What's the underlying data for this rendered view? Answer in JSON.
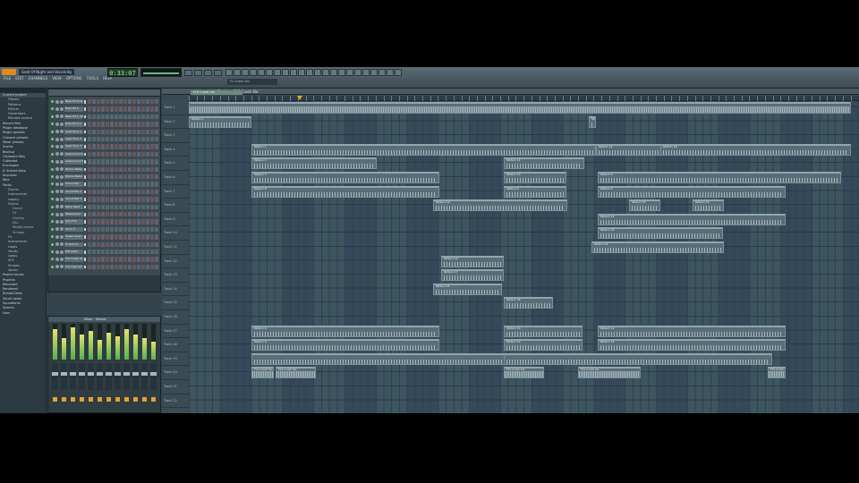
{
  "app": {
    "title": "FL Studio",
    "project_title": "Gold Of Night and Vocals-By"
  },
  "menu": [
    "FILE",
    "EDIT",
    "CHANNELS",
    "VIEW",
    "OPTIONS",
    "TOOLS",
    "HELP"
  ],
  "transport": {
    "time": "0:33:07"
  },
  "hint": "FL Crash Slo",
  "browser": {
    "items": [
      {
        "label": "Current project",
        "level": 0
      },
      {
        "label": "History",
        "level": 1
      },
      {
        "label": "Patterns",
        "level": 1
      },
      {
        "label": "Effects",
        "level": 1
      },
      {
        "label": "Generators",
        "level": 1
      },
      {
        "label": "Remote control",
        "level": 1
      },
      {
        "label": "Recent files",
        "level": 0
      },
      {
        "label": "Plugin database",
        "level": 0
      },
      {
        "label": "Plugin presets",
        "level": 0
      },
      {
        "label": "Channel presets",
        "level": 0
      },
      {
        "label": "Mixer presets",
        "level": 0
      },
      {
        "label": "Scores",
        "level": 0
      },
      {
        "label": "Backup",
        "level": 0
      },
      {
        "label": "Clipboard files",
        "level": 0
      },
      {
        "label": "Collected",
        "level": 0
      },
      {
        "label": "Envelopes",
        "level": 0
      },
      {
        "label": "IL Shared Data",
        "level": 0
      },
      {
        "label": "Impulses",
        "level": 0
      },
      {
        "label": "Misc",
        "level": 0
      },
      {
        "label": "Packs",
        "level": 0
      },
      {
        "label": "Drums",
        "level": 1
      },
      {
        "label": "Instruments",
        "level": 1
      },
      {
        "label": "Legacy",
        "level": 1
      },
      {
        "label": "Drums",
        "level": 1
      },
      {
        "label": "Dance",
        "level": 2
      },
      {
        "label": "FX",
        "level": 2
      },
      {
        "label": "HipHop",
        "level": 2
      },
      {
        "label": "Kits",
        "level": 2
      },
      {
        "label": "RealDrumkits",
        "level": 2
      },
      {
        "label": "Vintage",
        "level": 2
      },
      {
        "label": "FX",
        "level": 1
      },
      {
        "label": "Instruments",
        "level": 1
      },
      {
        "label": "Loops",
        "level": 1
      },
      {
        "label": "Vocals",
        "level": 1
      },
      {
        "label": "Loops",
        "level": 1
      },
      {
        "label": "SFX",
        "level": 1
      },
      {
        "label": "Shapes",
        "level": 1
      },
      {
        "label": "Vocals",
        "level": 1
      },
      {
        "label": "Project bones",
        "level": 0
      },
      {
        "label": "Projects",
        "level": 0
      },
      {
        "label": "Recorded",
        "level": 0
      },
      {
        "label": "Rendered",
        "level": 0
      },
      {
        "label": "Shared Data",
        "level": 0
      },
      {
        "label": "Sliced beats",
        "level": 0
      },
      {
        "label": "Soundfonts",
        "level": 0
      },
      {
        "label": "Speech",
        "level": 0
      },
      {
        "label": "User",
        "level": 0
      }
    ]
  },
  "channels": [
    "Bass Kit (Lead)",
    "Bass Kit 2",
    "Bass Kit 2 (dl)",
    "Bass Kit 3 e",
    "Lead Tone 1",
    "Lead Tone 2",
    "Lead Tone 3",
    "Lead Sound 2",
    "Lead Sound 4",
    "Plucks Metal",
    "Plucks Metal",
    "Chord Pad",
    "Chord Pad b",
    "Chord Pad 2",
    "Warp Lead",
    "Wavestand",
    "Kick Frill",
    "Pluck 2",
    "Vowel Layer",
    "Hi Hat C1",
    "Hat Open",
    "FLS Crash Slo",
    "FLS Clap Slo"
  ],
  "mixer": {
    "title": "Mixer - Master",
    "levels": [
      0.85,
      0.6,
      0.9,
      0.7,
      0.8,
      0.55,
      0.75,
      0.65,
      0.85,
      0.7,
      0.6,
      0.5
    ]
  },
  "playlist": {
    "title": "Playlist - FLS Crash Slo",
    "pattern_selector": "FLS Crash Slo",
    "tracks": [
      "Track 1",
      "Track 2",
      "Track 3",
      "Track 4",
      "Track 5",
      "Track 6",
      "Track 7",
      "Track 8",
      "Track 9",
      "Track 10",
      "Track 11",
      "Track 12",
      "Track 13",
      "Track 14",
      "Track 15",
      "Track 16",
      "Track 17",
      "Track 18",
      "Track 19",
      "Track 20",
      "Track 21",
      "Track 22"
    ],
    "clips": [
      {
        "label": "",
        "track": 0,
        "start": 0,
        "len": 740,
        "kind": "wave"
      },
      {
        "label": "Pattern 1",
        "track": 1,
        "start": 0,
        "len": 70,
        "kind": "notes"
      },
      {
        "label": "Pattern 2",
        "track": 1,
        "start": 447,
        "len": 8,
        "kind": "notes"
      },
      {
        "label": "Pattern 1",
        "track": 3,
        "start": 70,
        "len": 385,
        "kind": "notes"
      },
      {
        "label": "Pattern 14",
        "track": 3,
        "start": 455,
        "len": 100,
        "kind": "notes"
      },
      {
        "label": "Pattern 18",
        "track": 3,
        "start": 527,
        "len": 213,
        "kind": "notes"
      },
      {
        "label": "Pattern 4",
        "track": 4,
        "start": 70,
        "len": 140,
        "kind": "notes"
      },
      {
        "label": "Pattern 11",
        "track": 4,
        "start": 352,
        "len": 90,
        "kind": "notes"
      },
      {
        "label": "Pattern 7",
        "track": 5,
        "start": 70,
        "len": 210,
        "kind": "notes"
      },
      {
        "label": "Pattern 13",
        "track": 5,
        "start": 352,
        "len": 70,
        "kind": "notes"
      },
      {
        "label": "Pattern 5",
        "track": 5,
        "start": 457,
        "len": 272,
        "kind": "notes"
      },
      {
        "label": "Pattern 8",
        "track": 6,
        "start": 70,
        "len": 210,
        "kind": "notes"
      },
      {
        "label": "Pattern 9",
        "track": 6,
        "start": 352,
        "len": 70,
        "kind": "notes"
      },
      {
        "label": "Pattern 3",
        "track": 6,
        "start": 457,
        "len": 210,
        "kind": "notes"
      },
      {
        "label": "Pattern 19",
        "track": 7,
        "start": 273,
        "len": 150,
        "kind": "notes"
      },
      {
        "label": "Pattern 20",
        "track": 7,
        "start": 492,
        "len": 35,
        "kind": "notes"
      },
      {
        "label": "Pattern 22",
        "track": 7,
        "start": 563,
        "len": 35,
        "kind": "notes"
      },
      {
        "label": "Pattern 21",
        "track": 8,
        "start": 457,
        "len": 210,
        "kind": "notes"
      },
      {
        "label": "Pattern 23",
        "track": 9,
        "start": 457,
        "len": 140,
        "kind": "notes"
      },
      {
        "label": "Pattern 24",
        "track": 10,
        "start": 450,
        "len": 148,
        "kind": "notes"
      },
      {
        "label": "Pattern 16",
        "track": 11,
        "start": 282,
        "len": 70,
        "kind": "notes"
      },
      {
        "label": "Pattern 17",
        "track": 12,
        "start": 282,
        "len": 70,
        "kind": "notes"
      },
      {
        "label": "Pattern 15",
        "track": 13,
        "start": 273,
        "len": 77,
        "kind": "notes"
      },
      {
        "label": "Pattern 26",
        "track": 14,
        "start": 352,
        "len": 55,
        "kind": "notes"
      },
      {
        "label": "Pattern 6",
        "track": 16,
        "start": 70,
        "len": 210,
        "kind": "notes"
      },
      {
        "label": "Pattern 10",
        "track": 16,
        "start": 352,
        "len": 88,
        "kind": "notes"
      },
      {
        "label": "Pattern 12",
        "track": 16,
        "start": 457,
        "len": 210,
        "kind": "notes"
      },
      {
        "label": "Pattern 6",
        "track": 17,
        "start": 70,
        "len": 210,
        "kind": "notes"
      },
      {
        "label": "Pattern 10",
        "track": 17,
        "start": 352,
        "len": 88,
        "kind": "notes"
      },
      {
        "label": "Pattern 12",
        "track": 17,
        "start": 457,
        "len": 210,
        "kind": "notes"
      },
      {
        "label": "",
        "track": 18,
        "start": 70,
        "len": 300,
        "kind": "notes"
      },
      {
        "label": "",
        "track": 18,
        "start": 352,
        "len": 300,
        "kind": "notes"
      },
      {
        "label": "FLS Crash Slo",
        "track": 19,
        "start": 70,
        "len": 25,
        "kind": "wave"
      },
      {
        "label": "FLS Crash Slo",
        "track": 19,
        "start": 97,
        "len": 45,
        "kind": "wave"
      },
      {
        "label": "FLS Crash Slo",
        "track": 19,
        "start": 352,
        "len": 45,
        "kind": "wave"
      },
      {
        "label": "FLS Crash Slo",
        "track": 19,
        "start": 435,
        "len": 70,
        "kind": "wave"
      },
      {
        "label": "FLS Crash Slo",
        "track": 19,
        "start": 647,
        "len": 20,
        "kind": "wave"
      }
    ]
  }
}
